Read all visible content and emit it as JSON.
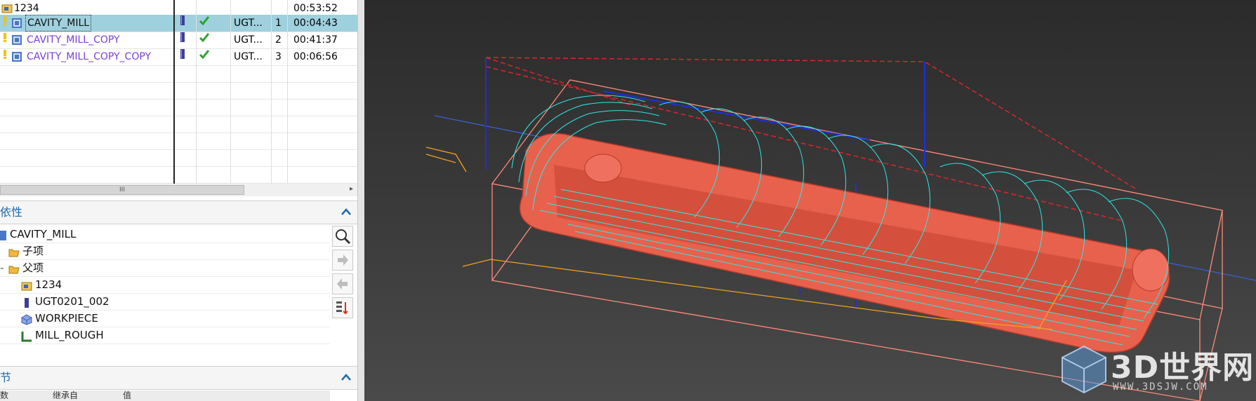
{
  "operations": {
    "rows": [
      {
        "name": "1234",
        "tool": "",
        "seq": "",
        "time": "00:53:52",
        "kind": "group"
      },
      {
        "name": "CAVITY_MILL",
        "tool": "UGT...",
        "seq": "1",
        "time": "00:04:43",
        "kind": "op",
        "selected": true
      },
      {
        "name": "CAVITY_MILL_COPY",
        "tool": "UGT...",
        "seq": "2",
        "time": "00:41:37",
        "kind": "op"
      },
      {
        "name": "CAVITY_MILL_COPY_COPY",
        "tool": "UGT...",
        "seq": "3",
        "time": "00:06:56",
        "kind": "op"
      }
    ],
    "status_icon": "green-check-icon",
    "scroll_thumb_glyph": "III"
  },
  "dependencies": {
    "title": "依性",
    "root": "CAVITY_MILL",
    "children_label": "子项",
    "parents_label": "父项",
    "parents": [
      "1234",
      "UGT0201_002",
      "WORKPIECE",
      "MILL_ROUGH"
    ]
  },
  "details": {
    "title": "节",
    "columns": [
      "数",
      "继承自",
      "值"
    ]
  },
  "watermark": {
    "text": "3D世界网",
    "url": "WWW.3DSJW.COM"
  },
  "colors": {
    "selection": "#9fd0de",
    "op_text": "#7a3fd0",
    "section_title": "#1f6aa8",
    "toolpath": "#2ee6e6",
    "part": "#e8614c"
  }
}
